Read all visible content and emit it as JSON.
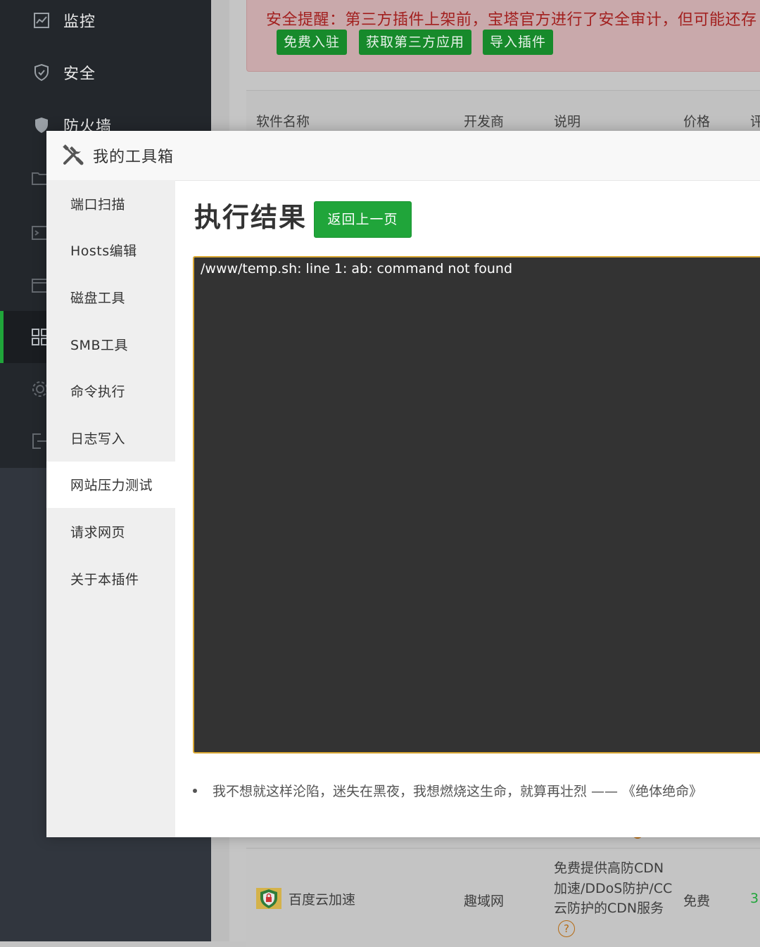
{
  "sidebar": {
    "items": [
      {
        "label": "监控",
        "icon": "monitor-icon"
      },
      {
        "label": "安全",
        "icon": "shield-icon"
      },
      {
        "label": "防火墙",
        "icon": "firewall-icon"
      }
    ]
  },
  "alert": {
    "text": "安全提醒：第三方插件上架前，宝塔官方进行了安全审计，但可能还存",
    "buttons": [
      "免费入驻",
      "获取第三方应用",
      "导入插件"
    ]
  },
  "table": {
    "headers": [
      "软件名称",
      "开发商",
      "说明",
      "价格",
      "评"
    ],
    "row": {
      "name": "百度云加速",
      "developer": "趣域网",
      "description": "免费提供高防CDN加速/DDoS防护/CC云防护的CDN服务",
      "price": "免费",
      "rating": "3."
    }
  },
  "modal": {
    "title": "我的工具箱",
    "nav": [
      "端口扫描",
      "Hosts编辑",
      "磁盘工具",
      "SMB工具",
      "命令执行",
      "日志写入",
      "网站压力测试",
      "请求网页",
      "关于本插件"
    ],
    "active_nav": "网站压力测试",
    "result_title": "执行结果",
    "back_button": "返回上一页",
    "output": "/www/temp.sh: line 1: ab: command not found",
    "quote": "我不想就这样沦陷，迷失在黑夜，我想燃烧这生命，就算再壮烈 —— 《绝体绝命》"
  },
  "colors": {
    "accent": "#20a53a",
    "terminal_bg": "#333333",
    "terminal_border": "#d9a733",
    "alert_text": "#a2201f"
  }
}
